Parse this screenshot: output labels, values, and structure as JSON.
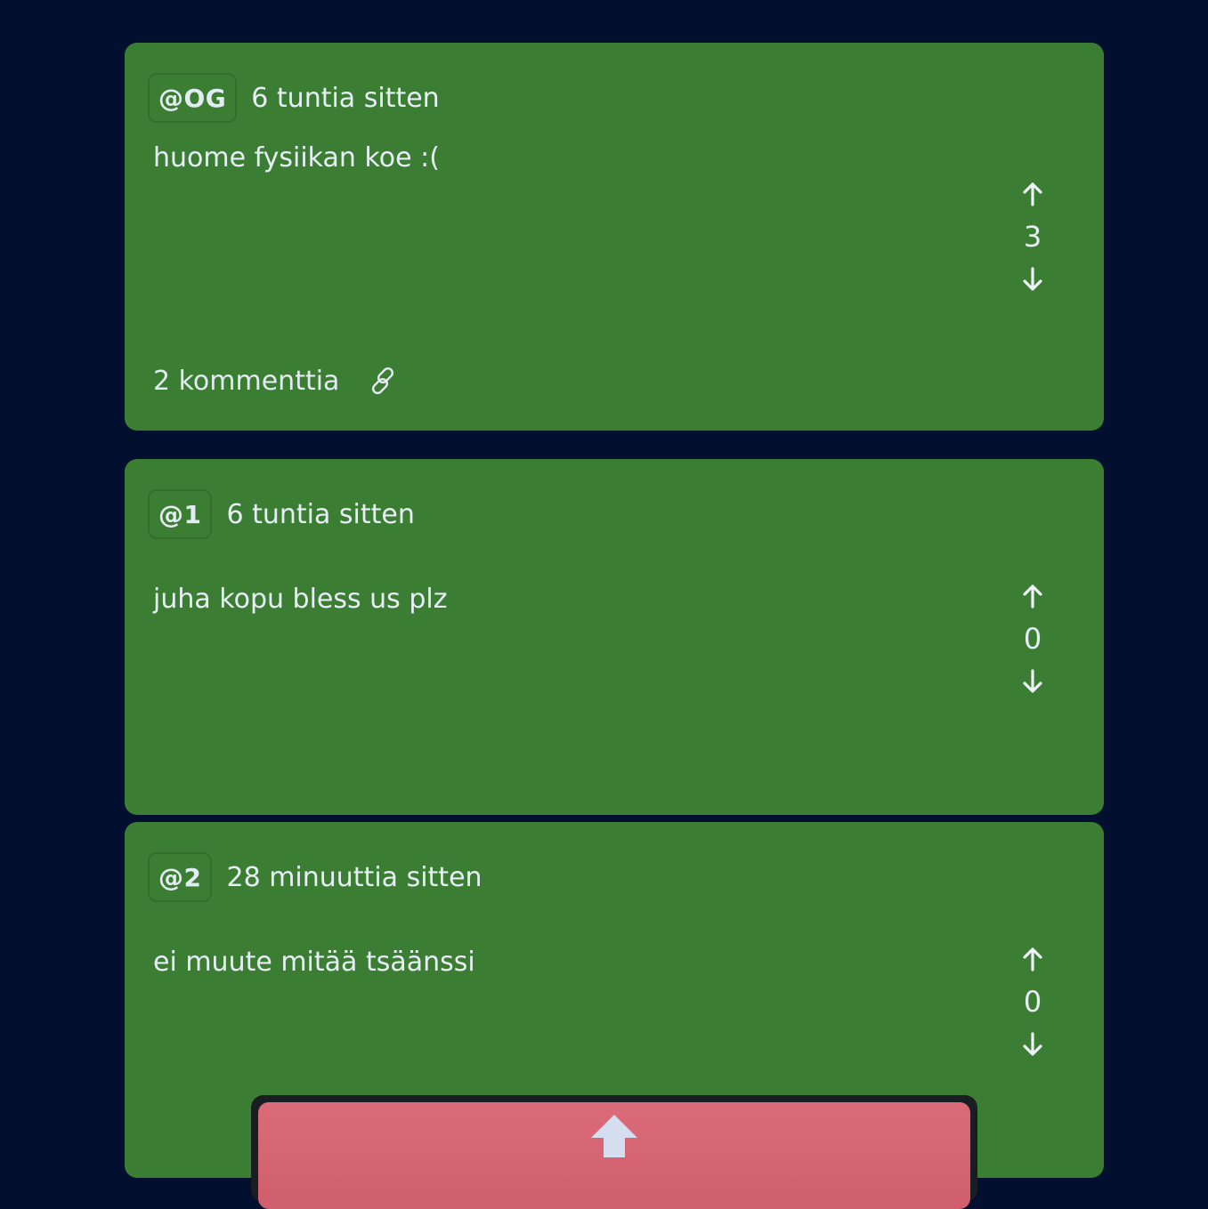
{
  "posts": [
    {
      "author": "@OG",
      "time": "6 tuntia sitten",
      "text": "huome fysiikan koe :(",
      "score": "3",
      "comments": "2 kommenttia"
    },
    {
      "author": "@1",
      "time": "6 tuntia sitten",
      "text": "juha kopu bless us plz",
      "score": "0"
    },
    {
      "author": "@2",
      "time": "28 minuuttia sitten",
      "text": "ei muute mitää tsäänssi",
      "score": "0"
    }
  ],
  "icons": {
    "upvote": "arrow-up-icon",
    "downvote": "arrow-down-icon",
    "link": "link-icon",
    "bottom": "big-arrow-up-icon"
  },
  "colors": {
    "background": "#020f2f",
    "card": "#3b7e33",
    "bottom_button": "#d96874"
  }
}
